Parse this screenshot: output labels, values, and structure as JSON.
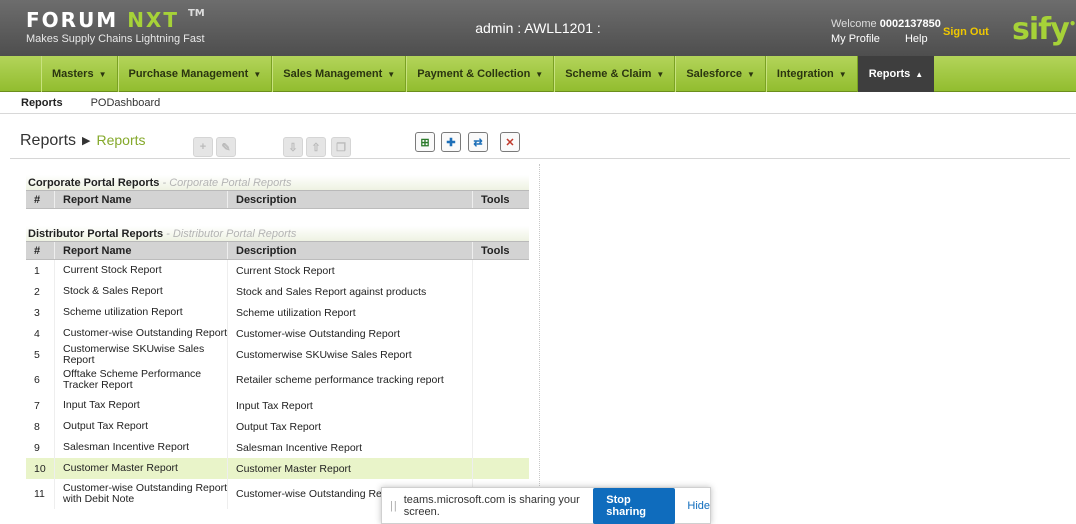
{
  "header": {
    "logo_forum": "FORUM",
    "logo_nxt": "NXT",
    "logo_tm": "TM",
    "tagline": "Makes Supply Chains Lightning Fast",
    "user_info": "admin : AWLL1201 :",
    "welcome_label": "Welcome",
    "welcome_id": "0002137850",
    "my_profile": "My Profile",
    "help": "Help",
    "sign_out": "Sign Out",
    "brand": "sify"
  },
  "nav": {
    "items": [
      {
        "label": "Masters"
      },
      {
        "label": "Purchase Management"
      },
      {
        "label": "Sales Management"
      },
      {
        "label": "Payment & Collection"
      },
      {
        "label": "Scheme & Claim"
      },
      {
        "label": "Salesforce"
      },
      {
        "label": "Integration"
      },
      {
        "label": "Reports"
      }
    ],
    "active_index": 7
  },
  "subnav": {
    "items": [
      "Reports",
      "PODashboard"
    ]
  },
  "page": {
    "title": "Reports",
    "breadcrumb": "Reports"
  },
  "corporate": {
    "title": "Corporate Portal Reports",
    "subtitle": "- Corporate Portal Reports",
    "headers": [
      "#",
      "Report Name",
      "Description",
      "Tools"
    ]
  },
  "distributor": {
    "title": "Distributor Portal Reports",
    "subtitle": "- Distributor Portal Reports",
    "headers": [
      "#",
      "Report Name",
      "Description",
      "Tools"
    ],
    "rows": [
      {
        "num": "1",
        "name": "Current Stock Report",
        "desc": "Current Stock Report"
      },
      {
        "num": "2",
        "name": "Stock & Sales Report",
        "desc": "Stock and Sales Report against products"
      },
      {
        "num": "3",
        "name": "Scheme utilization Report",
        "desc": "Scheme utilization Report"
      },
      {
        "num": "4",
        "name": "Customer-wise Outstanding Report",
        "desc": "Customer-wise Outstanding Report"
      },
      {
        "num": "5",
        "name": "Customerwise SKUwise Sales Report",
        "desc": "Customerwise SKUwise Sales Report"
      },
      {
        "num": "6",
        "name": "Offtake Scheme Performance Tracker Report",
        "desc": "Retailer scheme performance tracking report"
      },
      {
        "num": "7",
        "name": "Input Tax Report",
        "desc": "Input Tax Report"
      },
      {
        "num": "8",
        "name": "Output Tax Report",
        "desc": "Output Tax Report"
      },
      {
        "num": "9",
        "name": "Salesman Incentive Report",
        "desc": "Salesman Incentive Report"
      },
      {
        "num": "10",
        "name": "Customer Master Report",
        "desc": "Customer Master Report"
      },
      {
        "num": "11",
        "name": "Customer-wise Outstanding Report with Debit Note",
        "desc": "Customer-wise Outstanding Report"
      }
    ],
    "highlighted_row": 9
  },
  "share_bar": {
    "message": "teams.microsoft.com is sharing your screen.",
    "stop_label": "Stop sharing",
    "hide_label": "Hide"
  },
  "colors": {
    "accent_green": "#a6d238",
    "nav_green": "#9cc53c",
    "header_gray": "#5a5a5a",
    "teams_blue": "#0f6cbd",
    "row_highlight": "#e9f4c9"
  }
}
